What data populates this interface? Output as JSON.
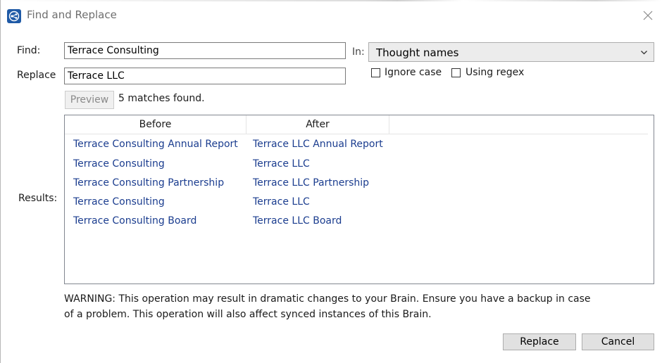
{
  "window": {
    "title": "Find and Replace"
  },
  "find": {
    "label": "Find:",
    "value": "Terrace Consulting"
  },
  "replace": {
    "label": "Replace",
    "value": "Terrace LLC"
  },
  "scope": {
    "label": "In:",
    "selected": "Thought names"
  },
  "options": {
    "ignore_case": "Ignore case",
    "using_regex": "Using regex"
  },
  "preview": {
    "button_label": "Preview",
    "status": "5 matches found."
  },
  "results": {
    "label": "Results:",
    "columns": [
      "Before",
      "After"
    ],
    "rows": [
      [
        "Terrace Consulting Annual Report",
        "Terrace LLC Annual Report"
      ],
      [
        "Terrace Consulting",
        "Terrace LLC"
      ],
      [
        "Terrace Consulting Partnership",
        "Terrace LLC Partnership"
      ],
      [
        "Terrace Consulting",
        "Terrace LLC"
      ],
      [
        "Terrace Consulting Board",
        "Terrace LLC Board"
      ]
    ]
  },
  "warning": {
    "line1": "WARNING: This operation may result in dramatic changes to your Brain. Ensure you have a backup in case",
    "line2": "of a problem. This operation will also affect synced instances of this Brain."
  },
  "actions": {
    "replace_label": "Replace",
    "cancel_label": "Cancel"
  },
  "colors": {
    "link_text": "#1b3d8f",
    "app_icon": "#1f5aa6"
  },
  "icons": {
    "app": "brain-app-icon",
    "close": "close-icon",
    "dropdown": "chevron-down-icon"
  }
}
